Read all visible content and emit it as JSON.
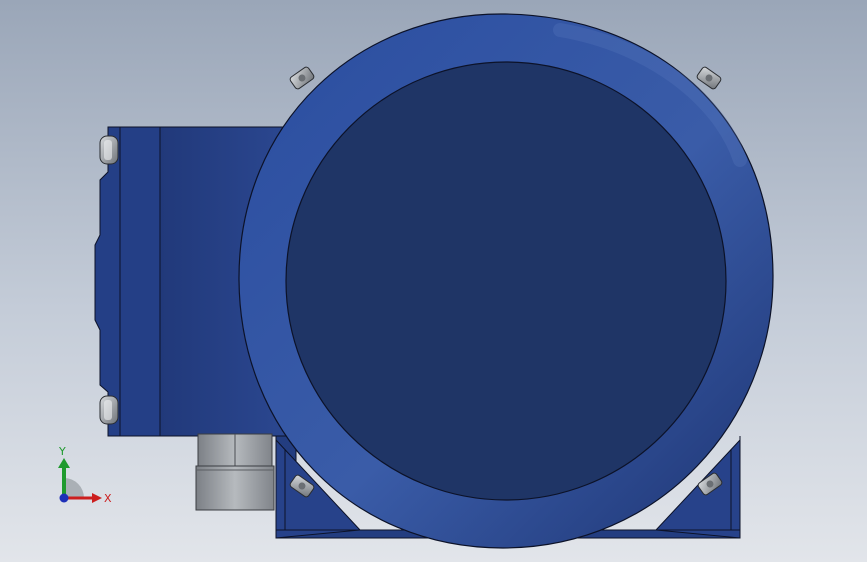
{
  "viewport": {
    "background_top": "#9aa6b8",
    "background_bottom": "#e2e5ea"
  },
  "model": {
    "body_color": "#2d4d96",
    "face_color": "#1f3566",
    "outline_color": "#0c1228",
    "fitting_color": "#9a9ea3"
  },
  "triad": {
    "x_label": "X",
    "y_label": "Y",
    "x_color": "#cc1e1e",
    "y_color": "#1f9a2e",
    "z_color": "#1e2fb8"
  }
}
